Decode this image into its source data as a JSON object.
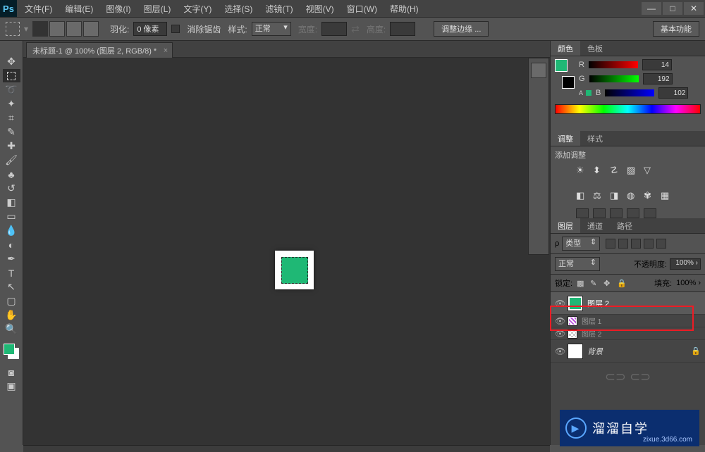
{
  "menubar": {
    "file": "文件(F)",
    "edit": "编辑(E)",
    "image": "图像(I)",
    "layer": "图层(L)",
    "type": "文字(Y)",
    "select": "选择(S)",
    "filter": "滤镜(T)",
    "view": "视图(V)",
    "window": "窗口(W)",
    "help": "帮助(H)"
  },
  "options": {
    "feather_label": "羽化:",
    "feather_value": "0 像素",
    "antialias_label": "消除锯齿",
    "style_label": "样式:",
    "style_value": "正常",
    "width_label": "宽度:",
    "height_label": "高度:",
    "refine_edge": "调整边缘 ...",
    "essentials": "基本功能"
  },
  "doc": {
    "title": "未标题-1 @ 100% (图层 2, RGB/8) *"
  },
  "colorpanel": {
    "tab_color": "颜色",
    "tab_swatches": "色板",
    "r_label": "R",
    "g_label": "G",
    "b_label": "B",
    "r_value": "14",
    "g_value": "192",
    "b_value": "102"
  },
  "adjust": {
    "tab_adjust": "调整",
    "tab_styles": "样式",
    "title": "添加调整"
  },
  "layers": {
    "tab_layers": "图层",
    "tab_channels": "通道",
    "tab_paths": "路径",
    "kind_label": "类型",
    "blend_mode": "正常",
    "opacity_label": "不透明度:",
    "opacity_value": "100%",
    "lock_label": "锁定:",
    "fill_label": "填充:",
    "fill_value": "100%",
    "layer2": "图层 2",
    "layer1": "图层 1",
    "layer2b": "图层 2",
    "bg": "背景"
  },
  "watermark": {
    "brand": "溜溜自学",
    "url": "zixue.3d66.com"
  },
  "colors": {
    "accent": "#1fb875"
  }
}
